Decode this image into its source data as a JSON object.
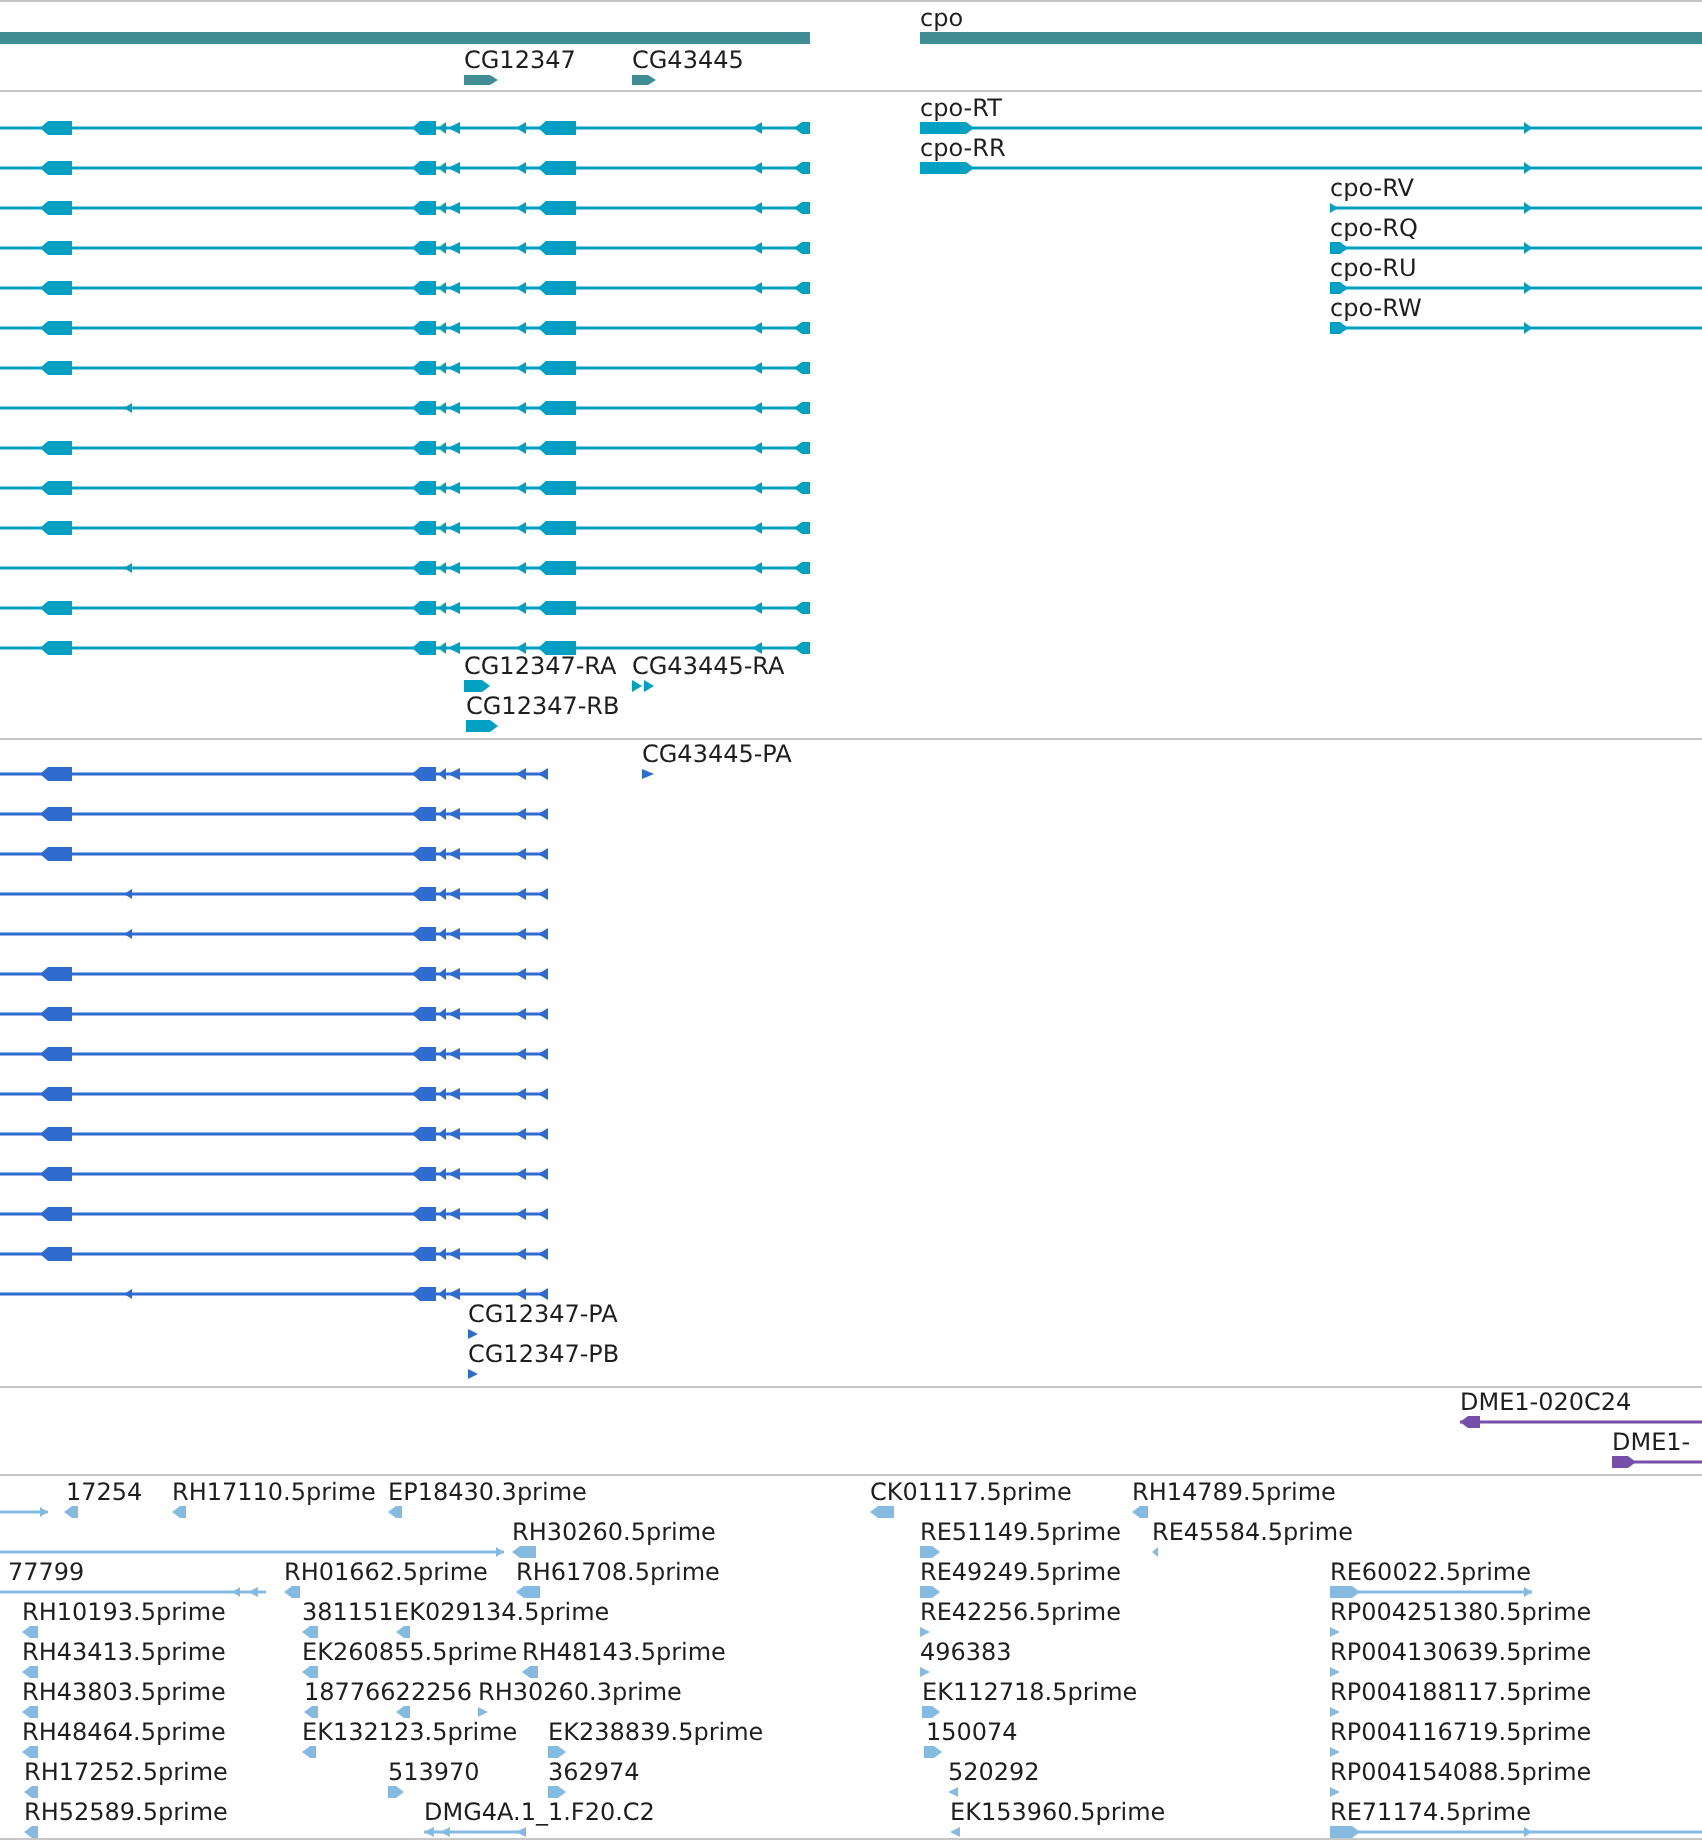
{
  "tracks": [
    {
      "kind": "gene",
      "features": [
        {
          "reverse": true
        },
        {
          "label": "cpo",
          "reverse": false
        },
        {
          "label": "CG12347",
          "reverse": false
        },
        {
          "label": "CG43445",
          "reverse": false
        }
      ]
    },
    {
      "kind": "transcript",
      "features": [
        {
          "reverse": true
        },
        {
          "reverse": true
        },
        {
          "reverse": true
        },
        {
          "reverse": true
        },
        {
          "reverse": true
        },
        {
          "reverse": true
        },
        {
          "reverse": true
        },
        {
          "reverse": true
        },
        {
          "reverse": true
        },
        {
          "reverse": true
        },
        {
          "reverse": true
        },
        {
          "reverse": true
        },
        {
          "reverse": true
        },
        {
          "reverse": true
        },
        {
          "label": "cpo-RT",
          "reverse": false
        },
        {
          "label": "cpo-RR",
          "reverse": false
        },
        {
          "label": "cpo-RV",
          "reverse": false
        },
        {
          "label": "cpo-RQ",
          "reverse": false
        },
        {
          "label": "cpo-RU",
          "reverse": false
        },
        {
          "label": "cpo-RW",
          "reverse": false
        },
        {
          "label": "CG12347-RA",
          "reverse": false
        },
        {
          "label": "CG43445-RA",
          "reverse": false
        },
        {
          "label": "CG12347-RB",
          "reverse": false
        }
      ]
    },
    {
      "kind": "protein",
      "features": [
        {
          "reverse": true
        },
        {
          "reverse": true
        },
        {
          "reverse": true
        },
        {
          "reverse": true
        },
        {
          "reverse": true
        },
        {
          "reverse": true
        },
        {
          "reverse": true
        },
        {
          "reverse": true
        },
        {
          "reverse": true
        },
        {
          "reverse": true
        },
        {
          "reverse": true
        },
        {
          "reverse": true
        },
        {
          "reverse": true
        },
        {
          "reverse": true
        },
        {
          "label": "CG43445-PA",
          "reverse": false
        },
        {
          "label": "CG12347-PA",
          "reverse": false
        },
        {
          "label": "CG12347-PB",
          "reverse": false
        }
      ]
    },
    {
      "kind": "clone",
      "features": [
        {
          "label": "DME1-020C24",
          "reverse": true
        },
        {
          "label": "DME1-",
          "reverse": false
        }
      ]
    },
    {
      "kind": "est",
      "features": [
        {
          "reverse": false
        },
        {
          "label": "17254",
          "reverse": true
        },
        {
          "label": "RH17110.5prime",
          "reverse": true
        },
        {
          "label": "EP18430.3prime",
          "reverse": true
        },
        {
          "label": "CK01117.5prime",
          "reverse": true
        },
        {
          "label": "RH14789.5prime",
          "reverse": true
        },
        {
          "reverse": false
        },
        {
          "label": "RH30260.5prime",
          "reverse": true
        },
        {
          "label": "RE51149.5prime",
          "reverse": false
        },
        {
          "label": "RE45584.5prime",
          "reverse": true
        },
        {
          "label": "77799",
          "reverse": true
        },
        {
          "label": "RH01662.5prime",
          "reverse": true
        },
        {
          "label": "RH61708.5prime",
          "reverse": true
        },
        {
          "label": "RE49249.5prime",
          "reverse": false
        },
        {
          "label": "RE60022.5prime",
          "reverse": false
        },
        {
          "label": "RH10193.5prime",
          "reverse": true
        },
        {
          "label": "381151",
          "reverse": true
        },
        {
          "label": "EK029134.5prime",
          "reverse": true
        },
        {
          "label": "RE42256.5prime",
          "reverse": false
        },
        {
          "label": "RP004251380.5prime",
          "reverse": false
        },
        {
          "label": "RH43413.5prime",
          "reverse": true
        },
        {
          "label": "EK260855.5prime",
          "reverse": true
        },
        {
          "label": "RH48143.5prime",
          "reverse": true
        },
        {
          "label": "496383",
          "reverse": false
        },
        {
          "label": "RP004130639.5prime",
          "reverse": false
        },
        {
          "label": "RH43803.5prime",
          "reverse": true
        },
        {
          "label": "18776622256",
          "reverse": true
        },
        {
          "reverse": true
        },
        {
          "label": "RH30260.3prime",
          "reverse": false
        },
        {
          "label": "EK112718.5prime",
          "reverse": false
        },
        {
          "label": "RP004188117.5prime",
          "reverse": false
        },
        {
          "label": "RH48464.5prime",
          "reverse": true
        },
        {
          "label": "EK132123.5prime",
          "reverse": true
        },
        {
          "label": "EK238839.5prime",
          "reverse": false
        },
        {
          "label": "150074",
          "reverse": false
        },
        {
          "label": "RP004116719.5prime",
          "reverse": false
        },
        {
          "label": "RH17252.5prime",
          "reverse": true
        },
        {
          "label": "513970",
          "reverse": false
        },
        {
          "label": "362974",
          "reverse": false
        },
        {
          "label": "520292",
          "reverse": true
        },
        {
          "label": "RP004154088.5prime",
          "reverse": false
        },
        {
          "label": "RH52589.5prime",
          "reverse": true
        },
        {
          "label": "DMG4A.1_1.F20.C2",
          "reverse": true
        },
        {
          "label": "EK153960.5prime",
          "reverse": true
        },
        {
          "label": "RE71174.5prime",
          "reverse": false
        }
      ]
    }
  ]
}
